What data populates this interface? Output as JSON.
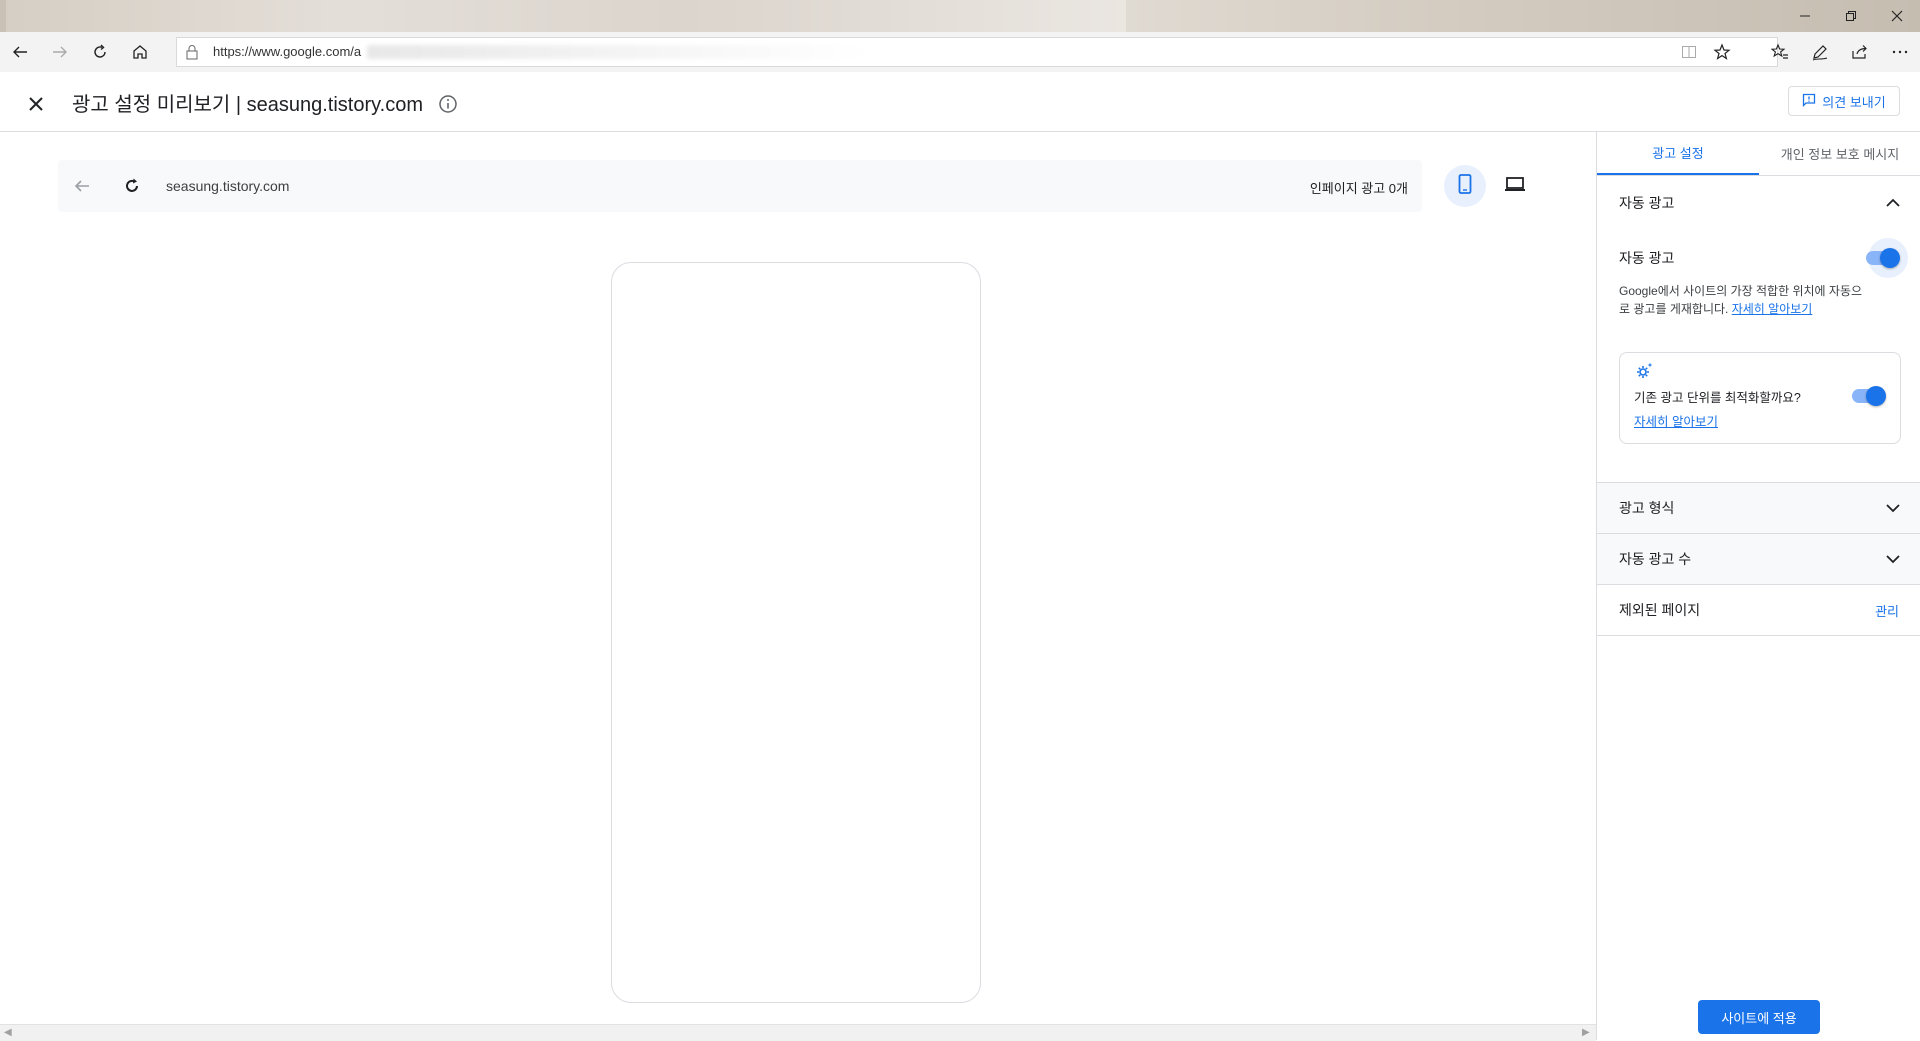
{
  "browser": {
    "url": "https://www.google.com/a",
    "icons": [
      "back-icon",
      "forward-icon",
      "refresh-icon",
      "home-icon",
      "lock-icon",
      "reading-view-icon",
      "star-icon",
      "favorites-icon",
      "pen-icon",
      "share-icon",
      "more-icon"
    ],
    "window_controls": [
      "minimize-icon",
      "restore-icon",
      "close-icon"
    ]
  },
  "header": {
    "title": "광고 설정 미리보기 | seasung.tistory.com",
    "feedback_label": "의견 보내기"
  },
  "preview": {
    "url": "seasung.tistory.com",
    "inpage_ad_count": "인페이지 광고 0개"
  },
  "panel": {
    "tabs": [
      {
        "label": "광고 설정",
        "active": true
      },
      {
        "label": "개인 정보 보호 메시지",
        "active": false
      }
    ],
    "auto_ads_section": {
      "heading": "자동 광고",
      "toggle_label": "자동 광고",
      "toggle_on": true,
      "description": "Google에서 사이트의 가장 적합한 위치에 자동으로 광고를 게재합니다. ",
      "learn_more": "자세히 알아보기",
      "optimize_question": "기존 광고 단위를 최적화할까요?",
      "optimize_on": true,
      "optimize_learn_more": "자세히 알아보기"
    },
    "ad_formats": "광고 형식",
    "ad_load": "자동 광고 수",
    "excluded_pages": "제외된 페이지",
    "manage": "관리",
    "apply_button": "사이트에 적용"
  },
  "colors": {
    "accent": "#1a73e8",
    "accent_light": "#8ab4f8",
    "border": "#dadce0"
  }
}
